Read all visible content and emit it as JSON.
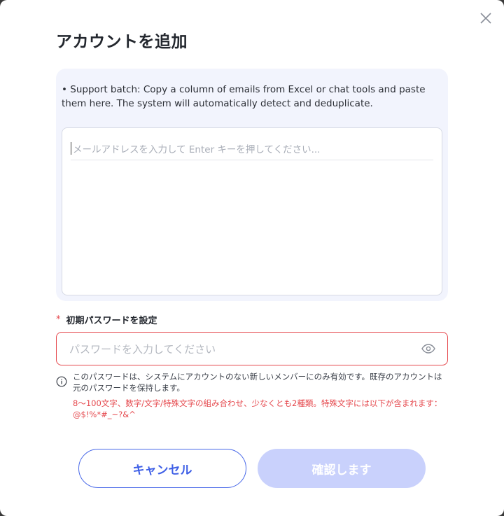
{
  "dialog": {
    "title": "アカウントを追加",
    "close_icon": "close-icon"
  },
  "email_section": {
    "hint": "• Support batch: Copy a column of emails from Excel or chat tools and paste them here. The system will automatically detect and deduplicate.",
    "input_value": "",
    "placeholder": "メールアドレスを入力して Enter キーを押してください..."
  },
  "password_section": {
    "required_mark": "*",
    "label": "初期パスワードを設定",
    "input_value": "",
    "placeholder": "パスワードを入力してください",
    "visibility_icon": "eye-icon",
    "info_icon": "info-icon",
    "info_text": "このパスワードは、システムにアカウントのない新しいメンバーにのみ有効です。既存のアカウントは元のパスワードを保持します。",
    "rule_text": "8～100文字、数字/文字/特殊文字の組み合わせ、少なくとも2種類。特殊文字には以下が含まれます：@$!%*#_~?&^"
  },
  "buttons": {
    "cancel_label": "キャンセル",
    "confirm_label": "確認します",
    "confirm_disabled": true
  },
  "colors": {
    "accent": "#3e5fe6",
    "error": "#e5484d",
    "panel_bg": "#f2f4fd",
    "confirm_disabled_bg": "#c9d1fc"
  }
}
